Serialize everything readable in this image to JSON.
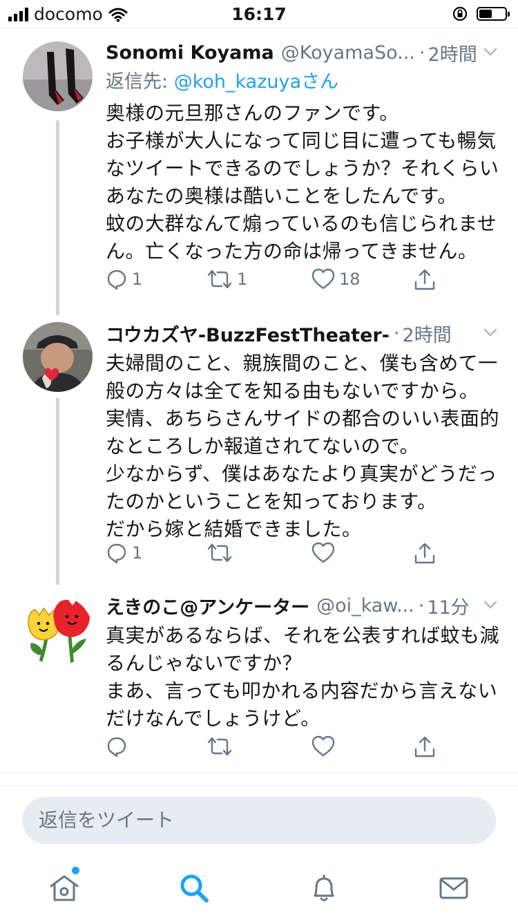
{
  "status_bar": {
    "carrier": "docomo",
    "time": "16:17"
  },
  "tweets": [
    {
      "name": "Sonomi Koyama",
      "handle": "@KoyamaSo...",
      "time": "2時間",
      "reply_to_prefix": "返信先: ",
      "reply_to_user": "@koh_kazuyaさん",
      "text": "奥様の元旦那さんのファンです。\nお子様が大人になって同じ目に遭っても暢気なツイートできるのでしょうか？それくらいあなたの奥様は酷いことをしたんです。\n蚊の大群なんて煽っているのも信じられません。亡くなった方の命は帰ってきません。",
      "reply_count": "1",
      "retweet_count": "1",
      "like_count": "18"
    },
    {
      "name": "コウカズヤ-BuzzFestTheater-",
      "handle": "",
      "time": "2時間",
      "text": "夫婦間のこと、親族間のこと、僕も含めて一般の方々は全てを知る由もないですから。\n実情、あちらさんサイドの都合のいい表面的なところしか報道されてないので。\n少なからず、僕はあなたより真実がどうだったのかということを知っております。\nだから嫁と結婚できました。",
      "reply_count": "1",
      "retweet_count": "",
      "like_count": ""
    },
    {
      "name": "えきのこ@アンケーター",
      "handle": "@oi_kaw...",
      "time": "11分",
      "text": "真実があるならば、それを公表すれば蚊も減るんじゃないですか？\nまあ、言っても叩かれる内容だから言えないだけなんでしょうけど。",
      "reply_count": "",
      "retweet_count": "",
      "like_count": ""
    }
  ],
  "composer": {
    "placeholder": "返信をツイート"
  },
  "icons": {
    "reply": "reply-icon",
    "retweet": "retweet-icon",
    "like": "heart-icon",
    "share": "share-icon",
    "home": "home-icon",
    "search": "search-icon",
    "notifications": "bell-icon",
    "messages": "mail-icon"
  },
  "colors": {
    "accent": "#1da1f2",
    "secondary_text": "#657786",
    "divider": "#e6ecf0",
    "reply_box": "#e6ecf0"
  }
}
